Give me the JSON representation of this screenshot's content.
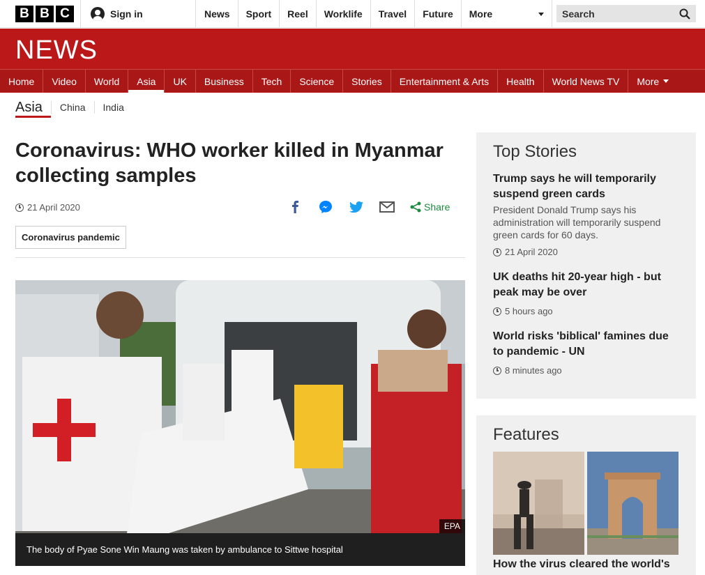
{
  "header": {
    "logo": [
      "B",
      "B",
      "C"
    ],
    "signin_label": "Sign in",
    "nav": [
      "News",
      "Sport",
      "Reel",
      "Worklife",
      "Travel",
      "Future"
    ],
    "more_label": "More",
    "search_placeholder": "Search"
  },
  "news_bar": {
    "title": "NEWS",
    "items": [
      "Home",
      "Video",
      "World",
      "Asia",
      "UK",
      "Business",
      "Tech",
      "Science",
      "Stories",
      "Entertainment & Arts",
      "Health",
      "World News TV"
    ],
    "active": "Asia",
    "more_label": "More"
  },
  "section_nav": {
    "current": "Asia",
    "items": [
      "China",
      "India"
    ]
  },
  "article": {
    "headline": "Coronavirus: WHO worker killed in Myanmar collecting samples",
    "date": "21 April 2020",
    "share_label": "Share",
    "tag": "Coronavirus pandemic",
    "image_credit": "EPA",
    "caption": "The body of Pyae Sone Win Maung was taken by ambulance to Sittwe hospital"
  },
  "top_stories": {
    "title": "Top Stories",
    "stories": [
      {
        "title": "Trump says he will temporarily suspend green cards",
        "summary": "President Donald Trump says his administration will temporarily suspend green cards for 60 days.",
        "time": "21 April 2020"
      },
      {
        "title": "UK deaths hit 20-year high - but peak may be over",
        "summary": "",
        "time": "5 hours ago"
      },
      {
        "title": "World risks 'biblical' famines due to pandemic - UN",
        "summary": "",
        "time": "8 minutes ago"
      }
    ]
  },
  "features": {
    "title": "Features",
    "first_title": "How the virus cleared the world's"
  },
  "colors": {
    "bbc_red": "#bb1919",
    "share_green": "#1d8a3f",
    "facebook_blue": "#3b5998",
    "twitter_blue": "#1da1f2"
  }
}
